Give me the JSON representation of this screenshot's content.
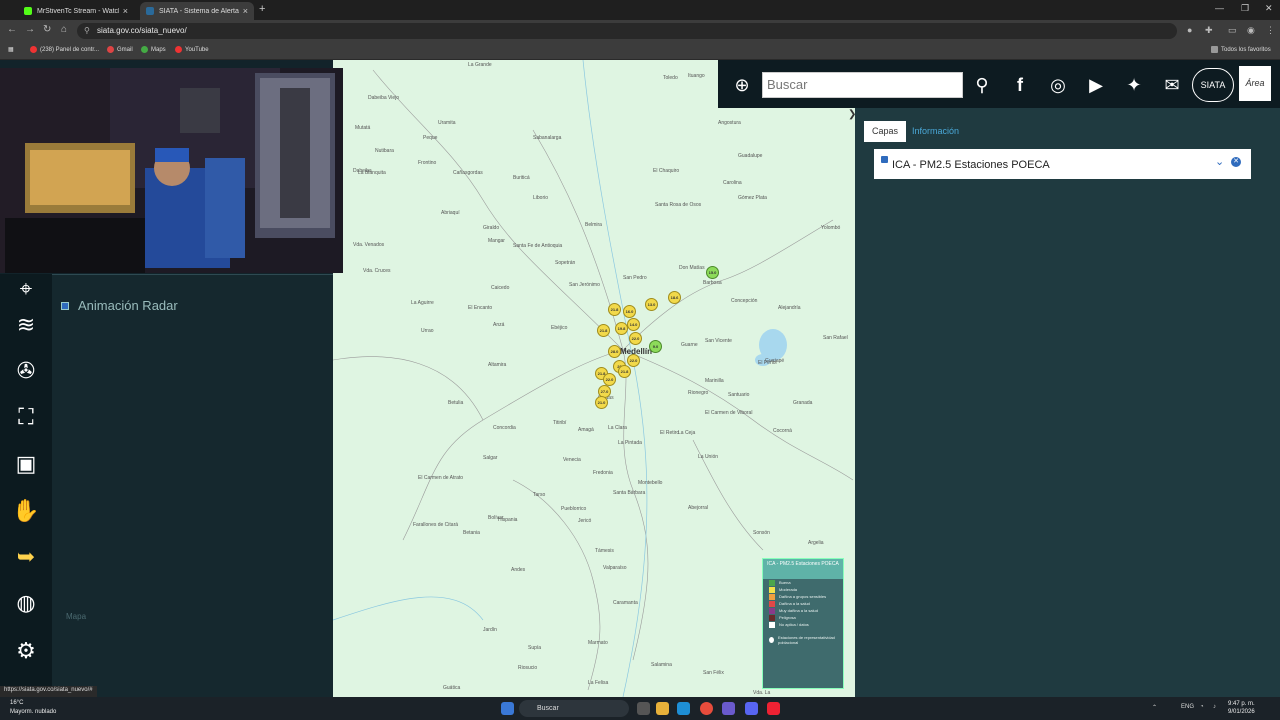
{
  "browser": {
    "tabs": [
      {
        "title": "MrStivenTc Stream - Watch Liv",
        "icon": "kick-icon"
      },
      {
        "title": "SIATA - Sistema de Alerta Temp",
        "icon": "siata-icon"
      }
    ],
    "url": "siata.gov.co/siata_nuevo/",
    "bookmarks": [
      "(238) Panel de contr...",
      "Gmail",
      "Maps",
      "YouTube"
    ],
    "all_bookmarks": "Todos los favoritos",
    "status_url": "https://siata.gov.co/siata_nuevo/#"
  },
  "topbar": {
    "search_placeholder": "Buscar",
    "logo_siata": "SIATA",
    "logo_area": "Área"
  },
  "right_panel": {
    "tab_capas": "Capas",
    "tab_info": "Información",
    "layer_title": "ICA - PM2.5 Estaciones POECA",
    "toggle": "❯"
  },
  "left_panel": {
    "radar_label": "Animación Radar",
    "mapa_label": "Mapa"
  },
  "map": {
    "city": "Medellín",
    "towns": [
      [
        "La Grande",
        135,
        2
      ],
      [
        "Frontino",
        85,
        100
      ],
      [
        "Cañasgordas",
        120,
        110
      ],
      [
        "Buriticá",
        180,
        115
      ],
      [
        "Liborio",
        200,
        135
      ],
      [
        "Peque",
        90,
        75
      ],
      [
        "Dabeiba Viejo",
        35,
        35
      ],
      [
        "Uramita",
        105,
        60
      ],
      [
        "Sabanalarga",
        200,
        75
      ],
      [
        "Toledo",
        330,
        15
      ],
      [
        "Ituango",
        355,
        13
      ],
      [
        "Angostura",
        385,
        60
      ],
      [
        "Guadalupe",
        405,
        93
      ],
      [
        "El Chaquiro",
        320,
        108
      ],
      [
        "Carolina",
        390,
        120
      ],
      [
        "Gómez Plata",
        405,
        135
      ],
      [
        "Santa Rosa de Osos",
        322,
        142
      ],
      [
        "Belmira",
        252,
        162
      ],
      [
        "Yolombó",
        488,
        165
      ],
      [
        "San Pedro",
        290,
        215
      ],
      [
        "Don Matías",
        346,
        205
      ],
      [
        "Barbosa",
        370,
        220
      ],
      [
        "Concepción",
        398,
        238
      ],
      [
        "Alejandría",
        445,
        245
      ],
      [
        "Sopetrán",
        222,
        200
      ],
      [
        "San Jerónimo",
        236,
        222
      ],
      [
        "Ebéjico",
        218,
        265
      ],
      [
        "Dabeiba",
        20,
        108
      ],
      [
        "Mutatá",
        22,
        65
      ],
      [
        "Nutibara",
        42,
        88
      ],
      [
        "La Blanquita",
        25,
        110
      ],
      [
        "Abriaquí",
        108,
        150
      ],
      [
        "Giraldo",
        150,
        165
      ],
      [
        "Santa Fe de Antioquia",
        180,
        183
      ],
      [
        "Vda. Venados",
        20,
        182
      ],
      [
        "Vda. Cruces",
        30,
        208
      ],
      [
        "Mangar",
        155,
        178
      ],
      [
        "Urrao",
        88,
        268
      ],
      [
        "La Aguirre",
        78,
        240
      ],
      [
        "El Encanto",
        135,
        245
      ],
      [
        "Caicedo",
        158,
        225
      ],
      [
        "Anzá",
        160,
        262
      ],
      [
        "San Vicente",
        372,
        278
      ],
      [
        "Guarne",
        348,
        282
      ],
      [
        "Marinilla",
        372,
        318
      ],
      [
        "El Peñol",
        425,
        300
      ],
      [
        "Guatapé",
        432,
        298
      ],
      [
        "San Rafael",
        490,
        275
      ],
      [
        "Granada",
        460,
        340
      ],
      [
        "Rionegro",
        355,
        330
      ],
      [
        "La Ceja",
        345,
        370
      ],
      [
        "El Carmen de Viboral",
        372,
        350
      ],
      [
        "La Unión",
        365,
        394
      ],
      [
        "Abejorral",
        355,
        445
      ],
      [
        "Sonsón",
        420,
        470
      ],
      [
        "Argelia",
        475,
        480
      ],
      [
        "Nariño",
        465,
        560
      ],
      [
        "Santa Bárbara",
        280,
        430
      ],
      [
        "Fredonia",
        260,
        410
      ],
      [
        "Montebello",
        305,
        420
      ],
      [
        "Venecia",
        230,
        397
      ],
      [
        "Jericó",
        245,
        458
      ],
      [
        "Tarso",
        200,
        432
      ],
      [
        "Pueblorrico",
        228,
        446
      ],
      [
        "Andes",
        178,
        507
      ],
      [
        "Jardín",
        150,
        567
      ],
      [
        "Támesis",
        262,
        488
      ],
      [
        "Valparaíso",
        270,
        505
      ],
      [
        "Caramanta",
        280,
        540
      ],
      [
        "La Pintada",
        285,
        380
      ],
      [
        "Amagá",
        245,
        367
      ],
      [
        "Titiribí",
        220,
        360
      ],
      [
        "Concordia",
        160,
        365
      ],
      [
        "Salgar",
        150,
        395
      ],
      [
        "Betulia",
        115,
        340
      ],
      [
        "El Carmen de Atrato",
        85,
        415
      ],
      [
        "Bolívar",
        155,
        455
      ],
      [
        "Betania",
        130,
        470
      ],
      [
        "Hispania",
        165,
        457
      ],
      [
        "Altamira",
        155,
        302
      ],
      [
        "El Retiro",
        327,
        370
      ],
      [
        "Caldas",
        265,
        335
      ],
      [
        "La Clara",
        275,
        365
      ],
      [
        "Cocorná",
        440,
        368
      ],
      [
        "Santuario",
        395,
        332
      ],
      [
        "Vda. La",
        420,
        630
      ],
      [
        "La Felisa",
        255,
        620
      ],
      [
        "Salamina",
        318,
        602
      ],
      [
        "San Félix",
        370,
        610
      ],
      [
        "Marmato",
        255,
        580
      ],
      [
        "Supía",
        195,
        585
      ],
      [
        "Riosucio",
        185,
        605
      ],
      [
        "Guática",
        110,
        625
      ],
      [
        "Farallones de Citará",
        80,
        462
      ]
    ],
    "stations": [
      [
        281,
        249,
        "21.8",
        "yellow"
      ],
      [
        296,
        251,
        "16.0",
        "yellow"
      ],
      [
        318,
        244,
        "13.0",
        "yellow"
      ],
      [
        341,
        237,
        "18.6",
        "yellow"
      ],
      [
        379,
        212,
        "15.0",
        "green"
      ],
      [
        270,
        270,
        "21.8",
        "yellow"
      ],
      [
        288,
        268,
        "19.8",
        "yellow"
      ],
      [
        300,
        264,
        "14.0",
        "yellow"
      ],
      [
        302,
        278,
        "22.0",
        "yellow"
      ],
      [
        281,
        291,
        "28.0",
        "yellow"
      ],
      [
        322,
        286,
        "9.0",
        "green"
      ],
      [
        300,
        300,
        "22.0",
        "yellow"
      ],
      [
        286,
        306,
        "29",
        "yellow"
      ],
      [
        291,
        311,
        "21.8",
        "yellow"
      ],
      [
        268,
        313,
        "21.8",
        "yellow"
      ],
      [
        276,
        319,
        "22.0",
        "yellow"
      ],
      [
        271,
        331,
        "27.0",
        "yellow"
      ],
      [
        268,
        342,
        "21.0",
        "yellow"
      ]
    ],
    "legend": {
      "title": "ICA - PM2.5 Estaciones POECA",
      "items": [
        [
          "Buena",
          "#4ca64c"
        ],
        [
          "Moderada",
          "#f3e24a"
        ],
        [
          "Dañina a grupos sensibles",
          "#f0a040"
        ],
        [
          "Dañina a la salud",
          "#e04848"
        ],
        [
          "Muy dañina a la salud",
          "#8a3a8a"
        ],
        [
          "Peligrosa",
          "#6a2a2a"
        ],
        [
          "No aplica / datos",
          "#ffffff"
        ]
      ],
      "footer": "Estaciones de representatividad poblacional"
    }
  },
  "taskbar": {
    "weather_temp": "16°C",
    "weather_desc": "Mayorm. nublado",
    "search": "Buscar",
    "lang": "ENG",
    "time": "9:47 p. m.",
    "date": "9/01/2026"
  }
}
